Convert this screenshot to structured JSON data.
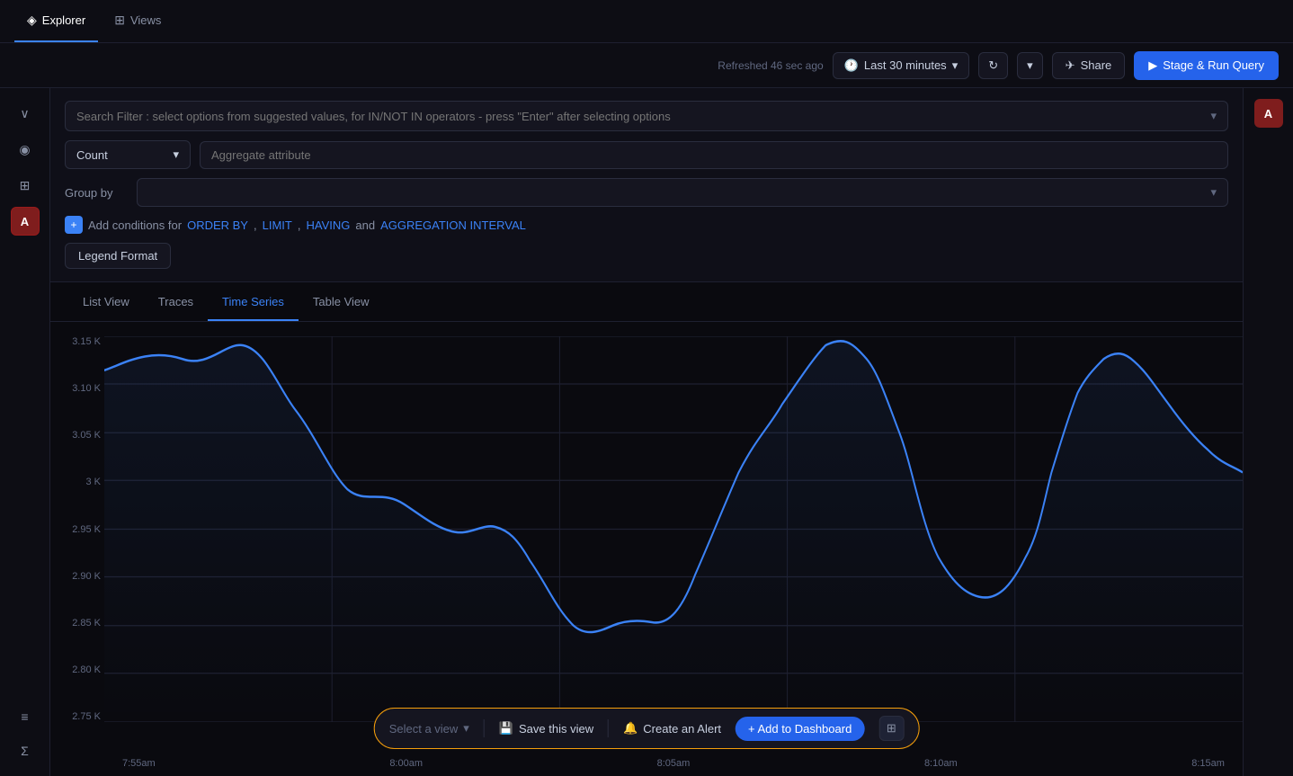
{
  "app": {
    "title": "Explorer"
  },
  "nav": {
    "tabs": [
      {
        "label": "Explorer",
        "icon": "◈",
        "active": true
      },
      {
        "label": "Views",
        "icon": "⊞",
        "active": false
      }
    ]
  },
  "toolbar": {
    "refresh_text": "Refreshed 46 sec ago",
    "time_range": "Last 30 minutes",
    "share_label": "Share",
    "stage_run_label": "Stage & Run Query"
  },
  "query": {
    "search_placeholder": "Search Filter : select options from suggested values, for IN/NOT IN operators - press \"Enter\" after selecting options",
    "count_label": "Count",
    "aggregate_placeholder": "Aggregate attribute",
    "group_by_label": "Group by",
    "conditions_prefix": "Add conditions for",
    "order_by_link": "ORDER BY",
    "comma1": ",",
    "limit_link": "LIMIT",
    "comma2": ",",
    "having_link": "HAVING",
    "and_text": "and",
    "aggregation_link": "AGGREGATION INTERVAL",
    "legend_format_label": "Legend Format"
  },
  "view_tabs": [
    {
      "label": "List View",
      "active": false
    },
    {
      "label": "Traces",
      "active": false
    },
    {
      "label": "Time Series",
      "active": true
    },
    {
      "label": "Table View",
      "active": false
    }
  ],
  "chart": {
    "y_labels": [
      "3.15 K",
      "3.10 K",
      "3.05 K",
      "3 K",
      "2.95 K",
      "2.90 K",
      "2.85 K",
      "2.80 K",
      "2.75 K"
    ],
    "x_labels": [
      "7:55am",
      "8:00am",
      "8:05am",
      "8:10am",
      "8:15am"
    ]
  },
  "action_bar": {
    "select_placeholder": "Select a view",
    "save_view_label": "Save this view",
    "create_alert_label": "Create an Alert",
    "add_dashboard_label": "+ Add to Dashboard"
  },
  "sidebar": {
    "top_icons": [
      "∨",
      "◉",
      "⊞"
    ],
    "avatar_label": "A",
    "bottom_icons": [
      "≡",
      "Σ"
    ]
  },
  "right_avatar": "A"
}
